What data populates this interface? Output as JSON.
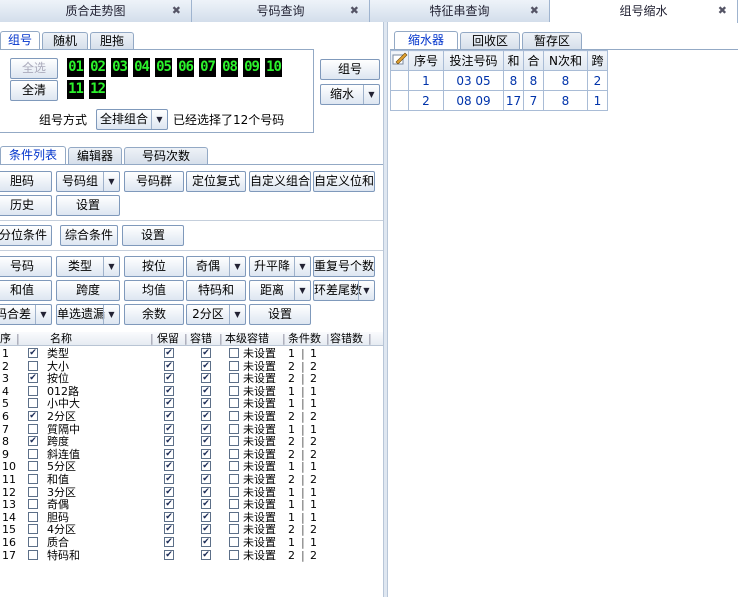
{
  "top_tabs": [
    {
      "label": "质合走势图",
      "active": false
    },
    {
      "label": "号码查询",
      "active": false
    },
    {
      "label": "特征串查询",
      "active": false
    },
    {
      "label": "组号缩水",
      "active": true
    }
  ],
  "left_tabs": [
    "组号",
    "随机",
    "胆拖"
  ],
  "buttons": {
    "select_all": "全选",
    "clear": "全清",
    "group": "组号",
    "shrink": "缩水"
  },
  "leds": [
    "01",
    "02",
    "03",
    "04",
    "05",
    "06",
    "07",
    "08",
    "09",
    "10",
    "11",
    "12"
  ],
  "group_method": {
    "label": "组号方式",
    "value": "全排组合",
    "status": "已经选择了12个号码"
  },
  "cond_tabs": [
    "条件列表",
    "编辑器",
    "号码次数"
  ],
  "cond_row1": [
    "胆码",
    "号码组",
    "号码群",
    "定位复式",
    "自定义组合",
    "自定义位和"
  ],
  "cond_row2": [
    "历史",
    "设置"
  ],
  "cond_row3": [
    "分位条件",
    "综合条件",
    "设置"
  ],
  "cond_row4": [
    "号码",
    "类型",
    "按位",
    "奇偶",
    "升平降",
    "重复号个数"
  ],
  "cond_row5": [
    "和值",
    "跨度",
    "均值",
    "特码和",
    "距离",
    "环差尾数"
  ],
  "cond_row6": [
    "码合差",
    "单选遗漏",
    "余数",
    "2分区",
    "设置"
  ],
  "list_header": [
    "序",
    "名称",
    "保留",
    "容错",
    "本级容错",
    "条件数",
    "容错数"
  ],
  "list_rows": [
    {
      "no": "1",
      "name": "类型",
      "checked": true,
      "level": "未设置",
      "c": "1",
      "e": "1"
    },
    {
      "no": "2",
      "name": "大小",
      "checked": false,
      "level": "未设置",
      "c": "2",
      "e": "2"
    },
    {
      "no": "3",
      "name": "按位",
      "checked": true,
      "level": "未设置",
      "c": "2",
      "e": "2"
    },
    {
      "no": "4",
      "name": "012路",
      "checked": false,
      "level": "未设置",
      "c": "1",
      "e": "1"
    },
    {
      "no": "5",
      "name": "小中大",
      "checked": false,
      "level": "未设置",
      "c": "1",
      "e": "1"
    },
    {
      "no": "6",
      "name": "2分区",
      "checked": true,
      "level": "未设置",
      "c": "2",
      "e": "2"
    },
    {
      "no": "7",
      "name": "質隔中",
      "checked": false,
      "level": "未设置",
      "c": "1",
      "e": "1"
    },
    {
      "no": "8",
      "name": "跨度",
      "checked": true,
      "level": "未设置",
      "c": "2",
      "e": "2"
    },
    {
      "no": "9",
      "name": "斜连值",
      "checked": false,
      "level": "未设置",
      "c": "2",
      "e": "2"
    },
    {
      "no": "10",
      "name": "5分区",
      "checked": false,
      "level": "未设置",
      "c": "1",
      "e": "1"
    },
    {
      "no": "11",
      "name": "和值",
      "checked": false,
      "level": "未设置",
      "c": "2",
      "e": "2"
    },
    {
      "no": "12",
      "name": "3分区",
      "checked": false,
      "level": "未设置",
      "c": "1",
      "e": "1"
    },
    {
      "no": "13",
      "name": "奇偶",
      "checked": false,
      "level": "未设置",
      "c": "1",
      "e": "1"
    },
    {
      "no": "14",
      "name": "胆码",
      "checked": false,
      "level": "未设置",
      "c": "1",
      "e": "1"
    },
    {
      "no": "15",
      "name": "4分区",
      "checked": false,
      "level": "未设置",
      "c": "2",
      "e": "2"
    },
    {
      "no": "16",
      "name": "质合",
      "checked": false,
      "level": "未设置",
      "c": "1",
      "e": "1"
    },
    {
      "no": "17",
      "name": "特码和",
      "checked": false,
      "level": "未设置",
      "c": "2",
      "e": "2"
    }
  ],
  "right_tabs": [
    "缩水器",
    "回收区",
    "暂存区"
  ],
  "right_table": {
    "headers": [
      "序号",
      "投注号码",
      "和",
      "合",
      "N次和",
      "跨"
    ],
    "rows": [
      [
        "1",
        "03 05",
        "8",
        "8",
        "8",
        "2"
      ],
      [
        "2",
        "08 09",
        "17",
        "7",
        "8",
        "1"
      ]
    ]
  }
}
